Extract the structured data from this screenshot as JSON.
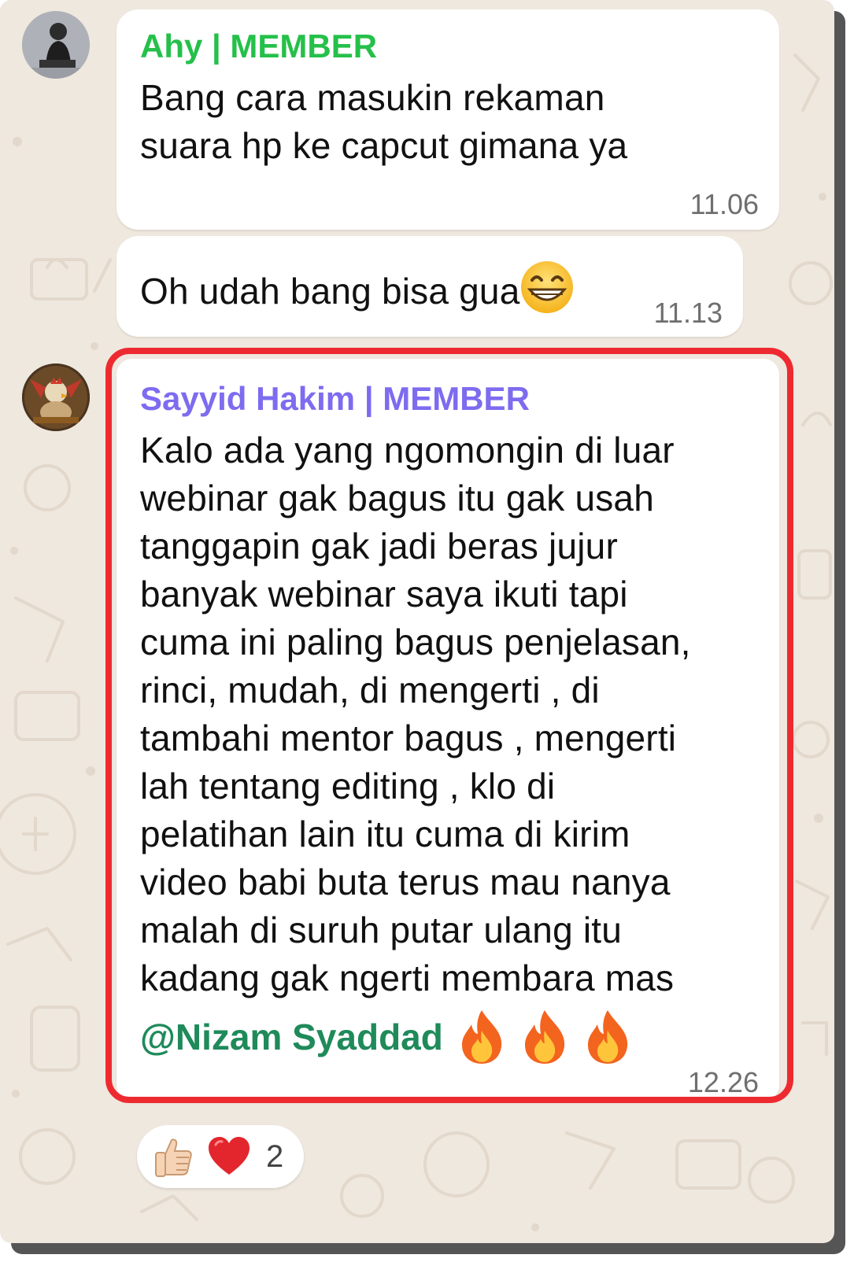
{
  "messages": [
    {
      "sender": "Ahy | MEMBER",
      "sender_color": "#25c04a",
      "text": "Bang cara masukin rekaman\nsuara hp ke capcut gimana ya",
      "time": "11.06"
    },
    {
      "text": "Oh udah bang bisa gua",
      "emoji": "grinning-face-emoji",
      "time": "11.13"
    },
    {
      "sender": "Sayyid Hakim | MEMBER",
      "sender_color": "#7d6bf0",
      "text": "Kalo ada yang ngomongin di luar\nwebinar gak bagus itu gak usah\ntanggapin gak jadi beras jujur\nbanyak webinar saya ikuti tapi\ncuma ini paling bagus penjelasan,\nrinci, mudah, di mengerti , di\ntambahi mentor bagus , mengerti\nlah tentang editing , klo di\npelatihan lain itu cuma di kirim\nvideo babi buta terus mau nanya\nmalah di suruh putar ulang itu\nkadang gak ngerti membara mas",
      "mention": "@Nizam Syaddad",
      "mention_color": "#1f8a5a",
      "emojis": [
        "fire-emoji",
        "fire-emoji",
        "fire-emoji"
      ],
      "time": "12.26",
      "highlight_color": "#ee2a31"
    }
  ],
  "reactions": {
    "icons": [
      "thumbs-up-emoji",
      "red-heart-emoji"
    ],
    "count": "2"
  }
}
